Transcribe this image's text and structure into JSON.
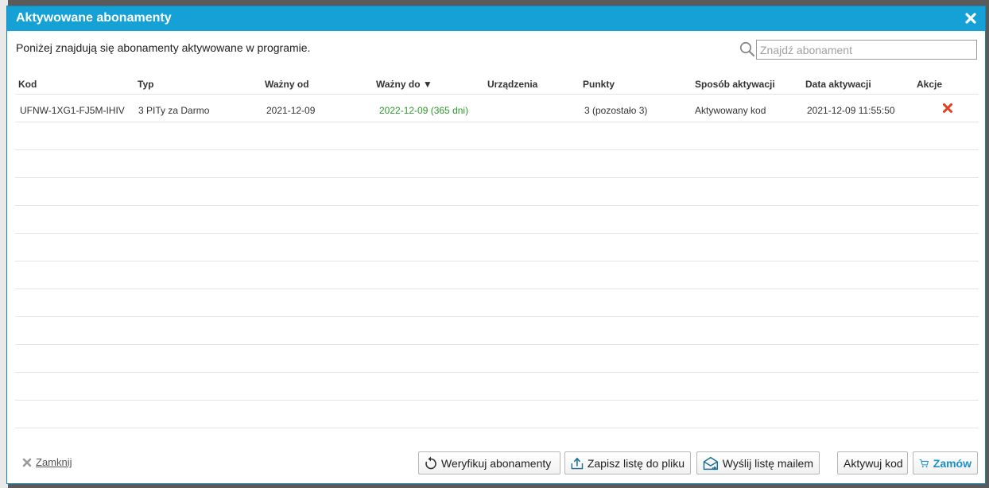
{
  "dialog": {
    "title": "Aktywowane abonamenty",
    "description": "Poniżej znajdują się abonamenty aktywowane w programie.",
    "search_placeholder": "Znajdź abonament"
  },
  "table": {
    "headers": {
      "kod": "Kod",
      "typ": "Typ",
      "wazny_od": "Ważny od",
      "wazny_do": "Ważny do ▼",
      "urzadzenia": "Urządzenia",
      "punkty": "Punkty",
      "sposob": "Sposób aktywacji",
      "data": "Data aktywacji",
      "akcje": "Akcje"
    },
    "rows": [
      {
        "kod": "UFNW-1XG1-FJ5M-IHIV",
        "typ": "3 PITy za Darmo",
        "wazny_od": "2021-12-09",
        "wazny_do": "2022-12-09 (365 dni)",
        "urzadzenia": "",
        "punkty": "3 (pozostało 3)",
        "sposob": "Aktywowany kod",
        "data": "2021-12-09 11:55:50"
      }
    ]
  },
  "footer": {
    "close_label": "Zamknij",
    "verify_label": "Weryfikuj abonamenty",
    "save_label": "Zapisz listę do pliku",
    "mail_label": "Wyślij listę mailem",
    "activate_label": "Aktywuj kod",
    "order_label": "Zamów"
  },
  "colors": {
    "titlebar": "#16a1d6",
    "valid_green": "#2b9a2b",
    "delete_red": "#e0401f",
    "order_blue": "#1a8fc9"
  }
}
